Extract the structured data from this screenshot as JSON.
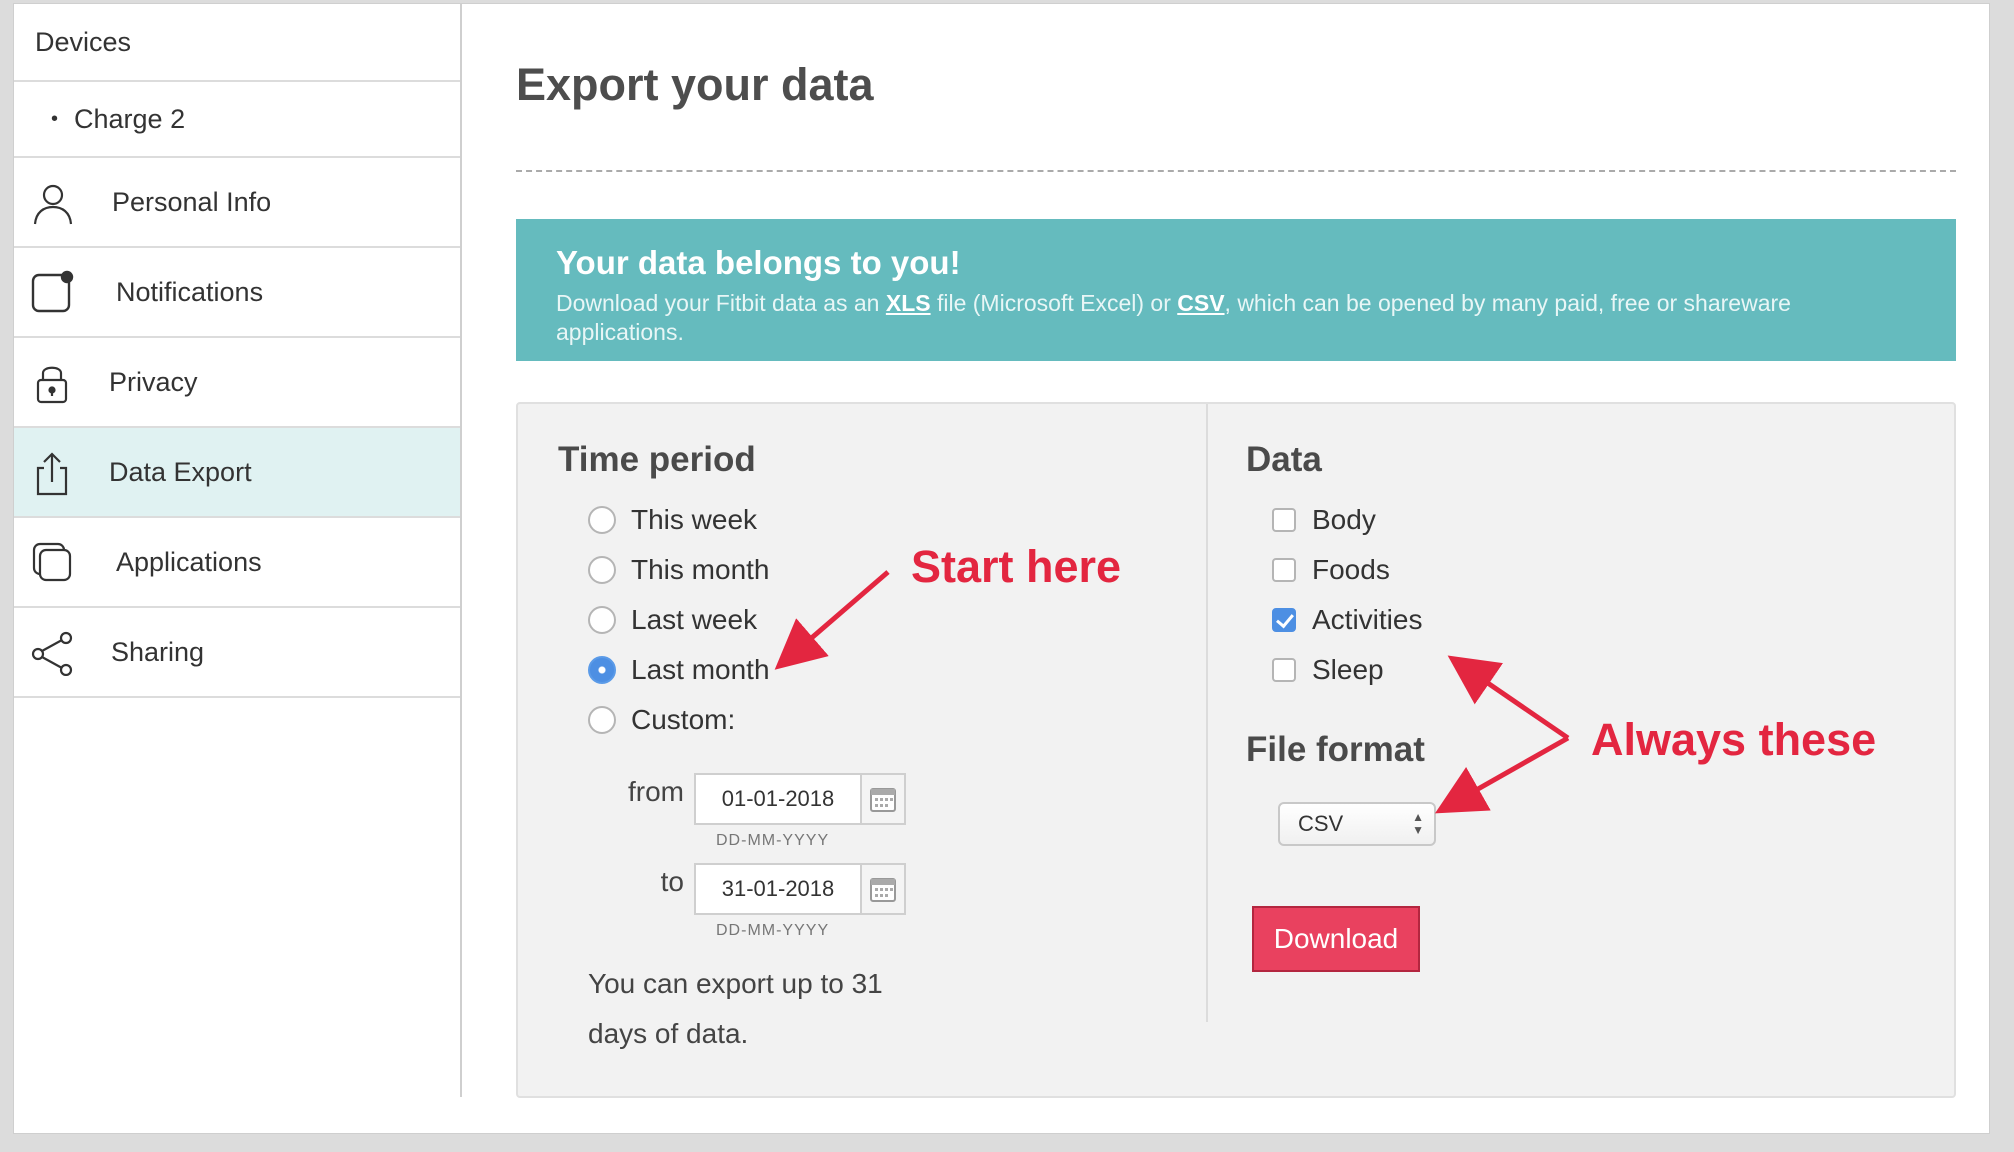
{
  "sidebar": {
    "devices_label": "Devices",
    "device_bullet": "•",
    "device_name": "Charge 2",
    "items": [
      {
        "label": "Personal Info",
        "icon": "person-icon"
      },
      {
        "label": "Notifications",
        "icon": "notification-icon"
      },
      {
        "label": "Privacy",
        "icon": "lock-icon"
      },
      {
        "label": "Data Export",
        "icon": "export-icon",
        "active": true
      },
      {
        "label": "Applications",
        "icon": "applications-icon"
      },
      {
        "label": "Sharing",
        "icon": "share-icon"
      }
    ]
  },
  "main": {
    "title": "Export your data",
    "banner": {
      "title": "Your data belongs to you!",
      "text_1": "Download your Fitbit data as an ",
      "link_xls": "XLS",
      "text_2": " file (Microsoft Excel) or ",
      "link_csv": "CSV",
      "text_3": ", which can be opened by many paid, free or shareware applications."
    },
    "time_period": {
      "title": "Time period",
      "options": [
        "This week",
        "This month",
        "Last week",
        "Last month",
        "Custom:"
      ],
      "selected": "Last month",
      "from_label": "from",
      "from_value": "01-01-2018",
      "to_label": "to",
      "to_value": "31-01-2018",
      "date_hint": "DD-MM-YYYY",
      "note": "You can export up to 31 days of data."
    },
    "data": {
      "title": "Data",
      "options": [
        {
          "label": "Body",
          "checked": false
        },
        {
          "label": "Foods",
          "checked": false
        },
        {
          "label": "Activities",
          "checked": true
        },
        {
          "label": "Sleep",
          "checked": false
        }
      ],
      "file_format_title": "File format",
      "file_format_value": "CSV",
      "download_label": "Download"
    }
  },
  "annotations": {
    "start_here": "Start here",
    "always_these": "Always these",
    "color": "#e32640"
  },
  "colors": {
    "banner": "#65bbbe",
    "download": "#e9415f",
    "active_nav": "#e0f2f2",
    "accent": "#4d8fe3"
  }
}
